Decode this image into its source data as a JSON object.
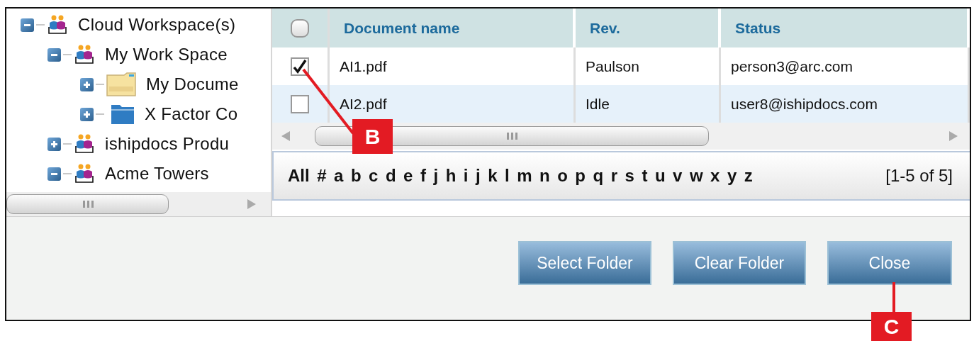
{
  "tree": [
    {
      "label": "Cloud Workspace(s)",
      "kind": "group",
      "expanded": true,
      "children": [
        {
          "label": "My Work Space",
          "kind": "group",
          "expanded": true,
          "children": [
            {
              "label": "My Docume",
              "kind": "documents",
              "expanded": false
            },
            {
              "label": "X Factor Co",
              "kind": "folder",
              "expanded": false
            }
          ]
        },
        {
          "label": "ishipdocs Produ",
          "kind": "group",
          "expanded": false
        },
        {
          "label": "Acme Towers",
          "kind": "group",
          "expanded": true
        }
      ]
    }
  ],
  "table": {
    "header_checkbox": {
      "checked": false
    },
    "columns": [
      "Document name",
      "Rev.",
      "Status"
    ],
    "rows": [
      {
        "checked": true,
        "cells": [
          "AI1.pdf",
          "Paulson",
          "person3@arc.com"
        ]
      },
      {
        "checked": false,
        "cells": [
          "AI2.pdf",
          "Idle",
          "user8@ishipdocs.com"
        ]
      }
    ]
  },
  "alphabet": [
    "All",
    "#",
    "a",
    "b",
    "c",
    "d",
    "e",
    "f",
    "j",
    "h",
    "i",
    "j",
    "k",
    "l",
    "m",
    "n",
    "o",
    "p",
    "q",
    "r",
    "s",
    "t",
    "u",
    "v",
    "w",
    "x",
    "y",
    "z"
  ],
  "count": "[1-5 of 5]",
  "buttons": [
    "Select Folder",
    "Clear Folder",
    "Close"
  ],
  "callouts": [
    "B",
    "C"
  ]
}
